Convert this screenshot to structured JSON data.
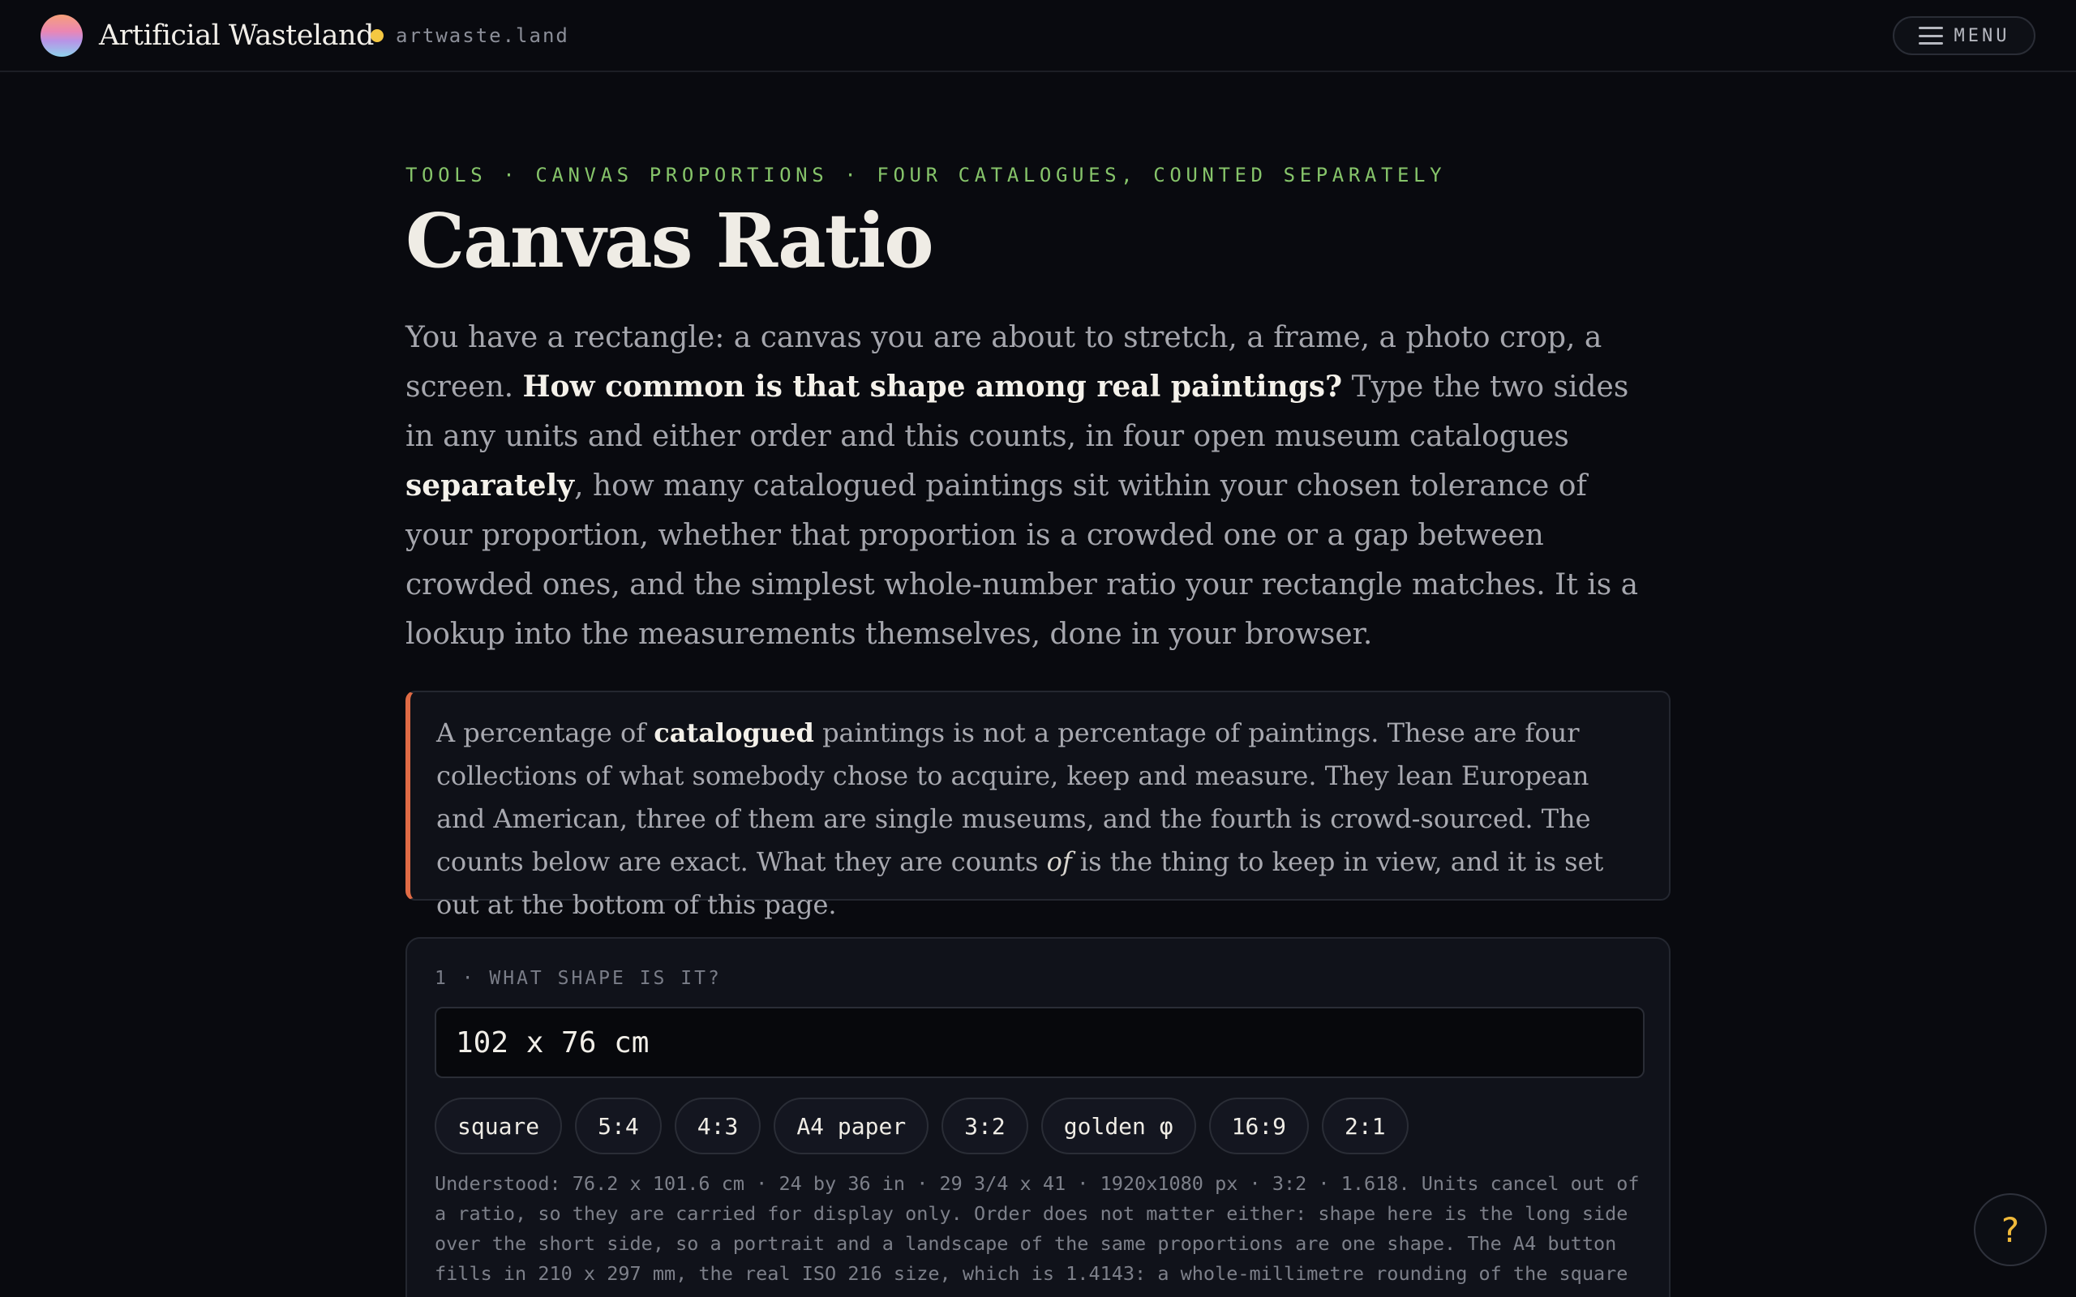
{
  "header": {
    "brand": "Artificial Wasteland",
    "domain": "artwaste.land",
    "menu_label": "MENU"
  },
  "page": {
    "eyebrow": "TOOLS · CANVAS PROPORTIONS · FOUR CATALOGUES, COUNTED SEPARATELY",
    "title": "Canvas Ratio",
    "intro": {
      "part1": "You have a rectangle: a canvas you are about to stretch, a frame, a photo crop, a screen. ",
      "bold1": "How common is that shape among real paintings?",
      "part2": " Type the two sides in any units and either order and this counts, in four open museum catalogues ",
      "bold2": "separately",
      "part3": ", how many catalogued paintings sit within your chosen tolerance of your proportion, whether that proportion is a crowded one or a gap between crowded ones, and the simplest whole-number ratio your rectangle matches. It is a lookup into the measurements themselves, done in your browser."
    },
    "callout": {
      "part1": "A percentage of ",
      "bold1": "catalogued",
      "part2": " paintings is not a percentage of paintings. These are four collections of what somebody chose to acquire, keep and measure. They lean European and American, three of them are single museums, and the fourth is crowd-sourced. The counts below are exact. What they are counts ",
      "italic1": "of",
      "part3": " is the thing to keep in view, and it is set out at the bottom of this page."
    }
  },
  "shape_panel": {
    "label": "1 · WHAT SHAPE IS IT?",
    "input_value": "102 x 76 cm",
    "presets": [
      {
        "label": "square"
      },
      {
        "label": "5:4"
      },
      {
        "label": "4:3"
      },
      {
        "label": "A4 paper"
      },
      {
        "label": "3:2"
      },
      {
        "label": "golden φ"
      },
      {
        "label": "16:9"
      },
      {
        "label": "2:1"
      }
    ],
    "understood": "Understood: 76.2 x 101.6 cm · 24 by 36 in · 29 3/4 x 41 · 1920x1080 px · 3:2 · 1.618. Units cancel out of a ratio, so they are carried for display only. Order does not matter either: shape here is the long side over the short side, so a portrait and a landscape of the same proportions are one shape. The A4 button fills in 210 x 297 mm, the real ISO 216 size, which is 1.4143: a whole-millimetre rounding of the square"
  },
  "help": {
    "label": "?"
  },
  "colors": {
    "background": "#090a0f",
    "accent_green": "#86c46a",
    "callout_border": "#e06b45",
    "status_dot": "#f5c842",
    "help_glyph": "#f0b93a"
  },
  "icons": [
    "logo-orb",
    "hamburger-icon",
    "help-icon"
  ]
}
